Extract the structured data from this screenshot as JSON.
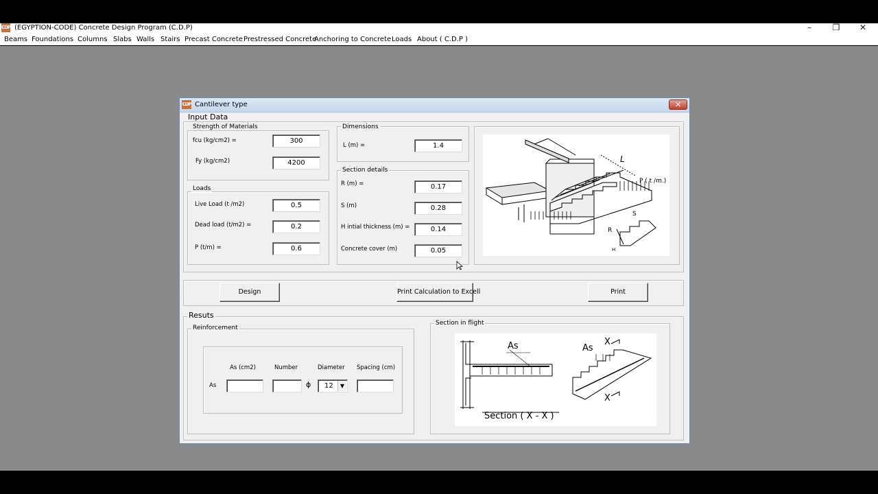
{
  "window": {
    "title": "(EGYPTION-CODE) Concrete Design Program (C.D.P)",
    "icon_text": "CDP",
    "minimize": "–",
    "restore": "❐",
    "close": "✕"
  },
  "menu": [
    "Beams",
    "Foundations",
    "Columns",
    "Slabs",
    "Walls",
    "Stairs",
    "Precast Concrete",
    "Prestressed Concrete",
    "Anchoring to Concrete",
    "Loads",
    "About ( C.D.P )"
  ],
  "dialog": {
    "title": "Cantilever type",
    "close": "✕",
    "input_data": "Input Data",
    "materials": {
      "legend": "Strength of  Materials",
      "fcu_label": "fcu  (kg/cm2) =",
      "fcu_value": "300",
      "fy_label": "Fy (kg/cm2)",
      "fy_value": "4200"
    },
    "loads": {
      "legend": "Loads",
      "live_label": "Live Load  (t /m2)",
      "live_value": "0.5",
      "dead_label": "Dead load (t/m2) =",
      "dead_value": "0.2",
      "p_label": "P (t/m) =",
      "p_value": "0.6"
    },
    "dimensions": {
      "legend": "Dimensions",
      "l_label": "L  (m) =",
      "l_value": "1.4"
    },
    "section_details": {
      "legend": "Section details",
      "r_label": "R  (m) =",
      "r_value": "0.17",
      "s_label": "S  (m)",
      "s_value": "0.28",
      "h_label": "H  intial thickness (m) =",
      "h_value": "0.14",
      "cover_label": "Concrete cover  (m)",
      "cover_value": "0.05"
    },
    "stair_picture": {
      "label_L": "L",
      "label_P": "P ( t /m.)",
      "label_S": "S",
      "label_R": "R",
      "label_H": "H"
    },
    "buttons": {
      "design": "Design",
      "print_calc": "Print Calculation to Excell",
      "print": "Print"
    },
    "results": {
      "legend": "Resuts",
      "reinforcement_legend": "Reinforcement",
      "col_as": "As (cm2)",
      "col_number": "Number",
      "col_diameter": "Diameter",
      "col_spacing": "Spacing  (cm)",
      "row_label": "As",
      "phi": "ϕ",
      "as_value": "",
      "number_value": "",
      "diameter_value": "12",
      "spacing_value": "",
      "section_legend": "Section in flight",
      "section_label": "Section ( X - X )",
      "label_As": "As",
      "label_X": "X"
    }
  }
}
